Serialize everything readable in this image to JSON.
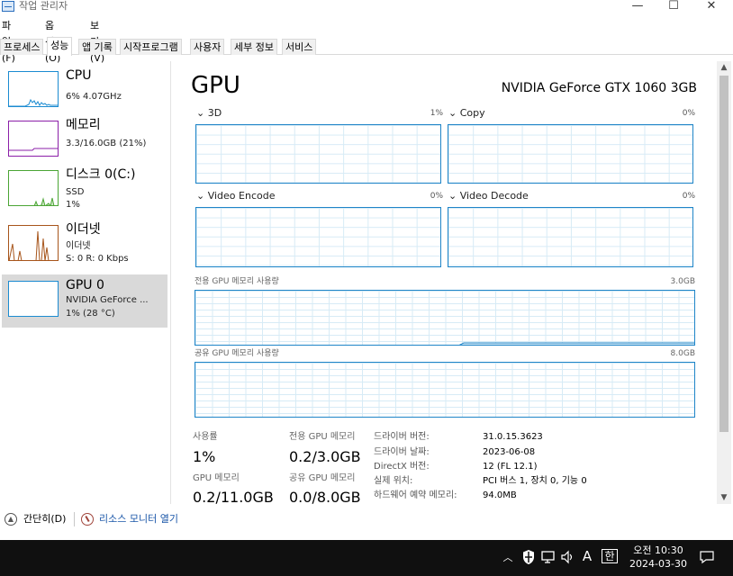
{
  "window": {
    "title": "작업 관리자",
    "controls": {
      "minimize": "—",
      "maximize": "☐",
      "close": "✕"
    }
  },
  "menu": {
    "items": [
      "파일(F)",
      "옵션(O)",
      "보기(V)"
    ]
  },
  "tabs": {
    "items": [
      "프로세스",
      "성능",
      "앱 기록",
      "시작프로그램",
      "사용자",
      "세부 정보",
      "서비스"
    ],
    "active": "성능"
  },
  "sidebar": {
    "items": [
      {
        "title": "CPU",
        "sub1": "6% 4.07GHz",
        "sub2": "",
        "sub3": "",
        "color": "#1b8bd1"
      },
      {
        "title": "메모리",
        "sub1": "3.3/16.0GB (21%)",
        "sub2": "",
        "sub3": "",
        "color": "#8b1fa8"
      },
      {
        "title": "디스크 0(C:)",
        "sub1": "SSD",
        "sub2": "1%",
        "sub3": "",
        "color": "#4ba534"
      },
      {
        "title": "이더넷",
        "sub1": "이더넷",
        "sub2": "S: 0 R: 0 Kbps",
        "sub3": "",
        "color": "#a7551b"
      },
      {
        "title": "GPU 0",
        "sub1": "NVIDIA GeForce ...",
        "sub2": "1% (28 °C)",
        "sub3": "",
        "color": "#1b8bd1"
      }
    ],
    "selected_index": 4
  },
  "main": {
    "title": "GPU",
    "model": "NVIDIA GeForce GTX 1060 3GB",
    "engines": [
      {
        "label": "3D",
        "percent": "1%"
      },
      {
        "label": "Copy",
        "percent": "0%"
      },
      {
        "label": "Video Encode",
        "percent": "0%"
      },
      {
        "label": "Video Decode",
        "percent": "0%"
      }
    ],
    "dedicated_memory": {
      "label": "전용 GPU 메모리 사용량",
      "max": "3.0GB",
      "used_fraction": 0.067
    },
    "shared_memory": {
      "label": "공유 GPU 메모리 사용량",
      "max": "8.0GB",
      "used_fraction": 0.0
    },
    "stats": {
      "utilization_label": "사용률",
      "utilization_value": "1%",
      "dedicated_label": "전용 GPU 메모리",
      "dedicated_value": "0.2/3.0GB",
      "gpu_memory_label": "GPU 메모리",
      "gpu_memory_value": "0.2/11.0GB",
      "shared_label": "공유 GPU 메모리",
      "shared_value": "0.0/8.0GB"
    },
    "details": [
      {
        "key": "드라이버 버전:",
        "value": "31.0.15.3623"
      },
      {
        "key": "드라이버 날짜:",
        "value": "2023-06-08"
      },
      {
        "key": "DirectX 버전:",
        "value": "12 (FL 12.1)"
      },
      {
        "key": "실제 위치:",
        "value": "PCI 버스 1, 장치 0, 기능 0"
      },
      {
        "key": "하드웨어 예약 메모리:",
        "value": "94.0MB"
      }
    ]
  },
  "footer": {
    "collapse_label": "간단히(D)",
    "resource_monitor_label": "리소스 모니터 열기"
  },
  "taskbar": {
    "ime": "A",
    "ime2": "한",
    "time": "오전 10:30",
    "date": "2024-03-30",
    "icons": [
      "chevron-up-icon",
      "shield-icon",
      "network-icon",
      "volume-icon"
    ]
  }
}
